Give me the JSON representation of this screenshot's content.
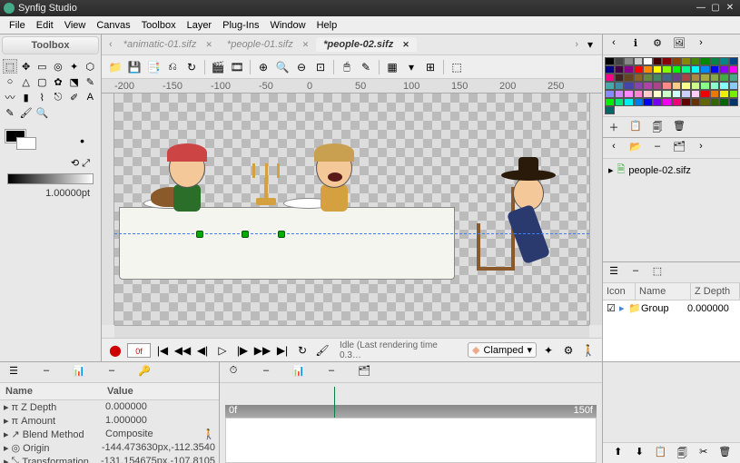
{
  "window": {
    "title": "Synfig Studio",
    "btn_min": "—",
    "btn_max": "▢",
    "btn_close": "✕"
  },
  "menu": [
    "File",
    "Edit",
    "View",
    "Canvas",
    "Toolbox",
    "Layer",
    "Plug-Ins",
    "Window",
    "Help"
  ],
  "toolbox": {
    "title": "Toolbox",
    "tools": [
      "⬚",
      "✥",
      "▭",
      "◎",
      "✦",
      "⬡",
      "○",
      "△",
      "▢",
      "✿",
      "⬔",
      "✎",
      "〰",
      "▮",
      "⌇",
      "⎋",
      "✐",
      "A",
      "✎",
      "🖌",
      "🔍"
    ],
    "reset": "⟲  ⤢",
    "width": "1.00000pt"
  },
  "tabs": {
    "nav_prev": "‹",
    "nav_next": "›",
    "close": "✕",
    "items": [
      {
        "label": "*animatic-01.sifz",
        "active": false
      },
      {
        "label": "*people-01.sifz",
        "active": false
      },
      {
        "label": "*people-02.sifz",
        "active": true
      }
    ]
  },
  "toolbar_icons": [
    "📁",
    "💾",
    "📑",
    "⎌",
    "↻",
    "|",
    "🎬",
    "🎞",
    "|",
    "⊕",
    "🔍",
    "⊖",
    "⊡",
    "|",
    "🖱",
    "✎",
    "|",
    "▦",
    "▾",
    "⊞",
    "|",
    "⬚"
  ],
  "ruler": [
    "-200",
    "-150",
    "-100",
    "-50",
    "0",
    "50",
    "100",
    "150",
    "200",
    "250"
  ],
  "playbar": {
    "rec": "⬤",
    "frame": "0f",
    "ctrls": [
      "|◀",
      "◀◀",
      "◀|",
      "▷",
      "|▶",
      "▶▶",
      "▶|",
      "↻",
      "🖌"
    ],
    "status": "Idle (Last rendering time 0.3…",
    "interp": "Clamped",
    "interp_caret": "▾",
    "right": [
      "✦",
      "⚙",
      "🚶"
    ]
  },
  "right": {
    "tabs": [
      "‹",
      "ℹ",
      "⚙",
      "🖼",
      "›"
    ],
    "pal_tools": [
      "＋",
      "📋",
      "🗐",
      "🗑"
    ],
    "file_tabs": [
      "‹",
      "📂",
      "–",
      "🗂",
      "›"
    ],
    "file_item": "people-02.sifz",
    "file_arrow": "▸",
    "file_icon": "🗎",
    "layer_tabs": [
      "☰",
      "–",
      "⬚"
    ],
    "lhdr": {
      "c1": "Icon",
      "c2": "Name",
      "c3": "Z Depth"
    },
    "lrow": {
      "check": "☑",
      "arrow": "▸",
      "icon": "📁",
      "name": "Group",
      "z": "0.000000"
    },
    "bbar": [
      "⬆",
      "⬇",
      "📋",
      "🗐",
      "✂",
      "🗑"
    ]
  },
  "palette_colors": [
    "#000",
    "#444",
    "#888",
    "#ccc",
    "#fff",
    "#400",
    "#800",
    "#840",
    "#880",
    "#480",
    "#080",
    "#084",
    "#088",
    "#048",
    "#008",
    "#404",
    "#808",
    "#f00",
    "#f80",
    "#ff0",
    "#8f0",
    "#0f0",
    "#0f8",
    "#0ff",
    "#08f",
    "#00f",
    "#80f",
    "#f0f",
    "#f08",
    "#422",
    "#642",
    "#862",
    "#684",
    "#486",
    "#468",
    "#648",
    "#a44",
    "#a84",
    "#aa4",
    "#8a4",
    "#4a4",
    "#4a8",
    "#4aa",
    "#48a",
    "#44a",
    "#84a",
    "#a4a",
    "#a48",
    "#f88",
    "#fc8",
    "#ff8",
    "#cf8",
    "#8f8",
    "#8fc",
    "#8ff",
    "#8cf",
    "#88f",
    "#c8f",
    "#f8f",
    "#f8c",
    "#fcc",
    "#ffc",
    "#cfc",
    "#cff",
    "#ccf",
    "#fcf",
    "#e00",
    "#e70",
    "#ee0",
    "#7e0",
    "#0e0",
    "#0e7",
    "#0ee",
    "#07e",
    "#00e",
    "#70e",
    "#e0e",
    "#e07",
    "#600",
    "#630",
    "#660",
    "#360",
    "#060",
    "#036",
    "#066"
  ],
  "params": {
    "tabs": [
      "☰",
      "–",
      "📊",
      "–",
      "🔑"
    ],
    "hdr": {
      "name": "Name",
      "value": "Value"
    },
    "rows": [
      {
        "icon": "π",
        "name": "Z Depth",
        "value": "0.000000"
      },
      {
        "icon": "π",
        "name": "Amount",
        "value": "1.000000"
      },
      {
        "icon": "↗",
        "name": "Blend Method",
        "value": "Composite",
        "extra": "🚶"
      },
      {
        "icon": "◎",
        "name": "Origin",
        "value": "-144.473630px,-112.3540"
      },
      {
        "icon": "⤡",
        "name": "Transformation",
        "value": "-131.154675px,-107.8105"
      }
    ]
  },
  "timeline": {
    "tabs": [
      "⏱",
      "–",
      "📊",
      "–",
      "🗂"
    ],
    "marks": [
      "0f",
      "150f"
    ]
  }
}
